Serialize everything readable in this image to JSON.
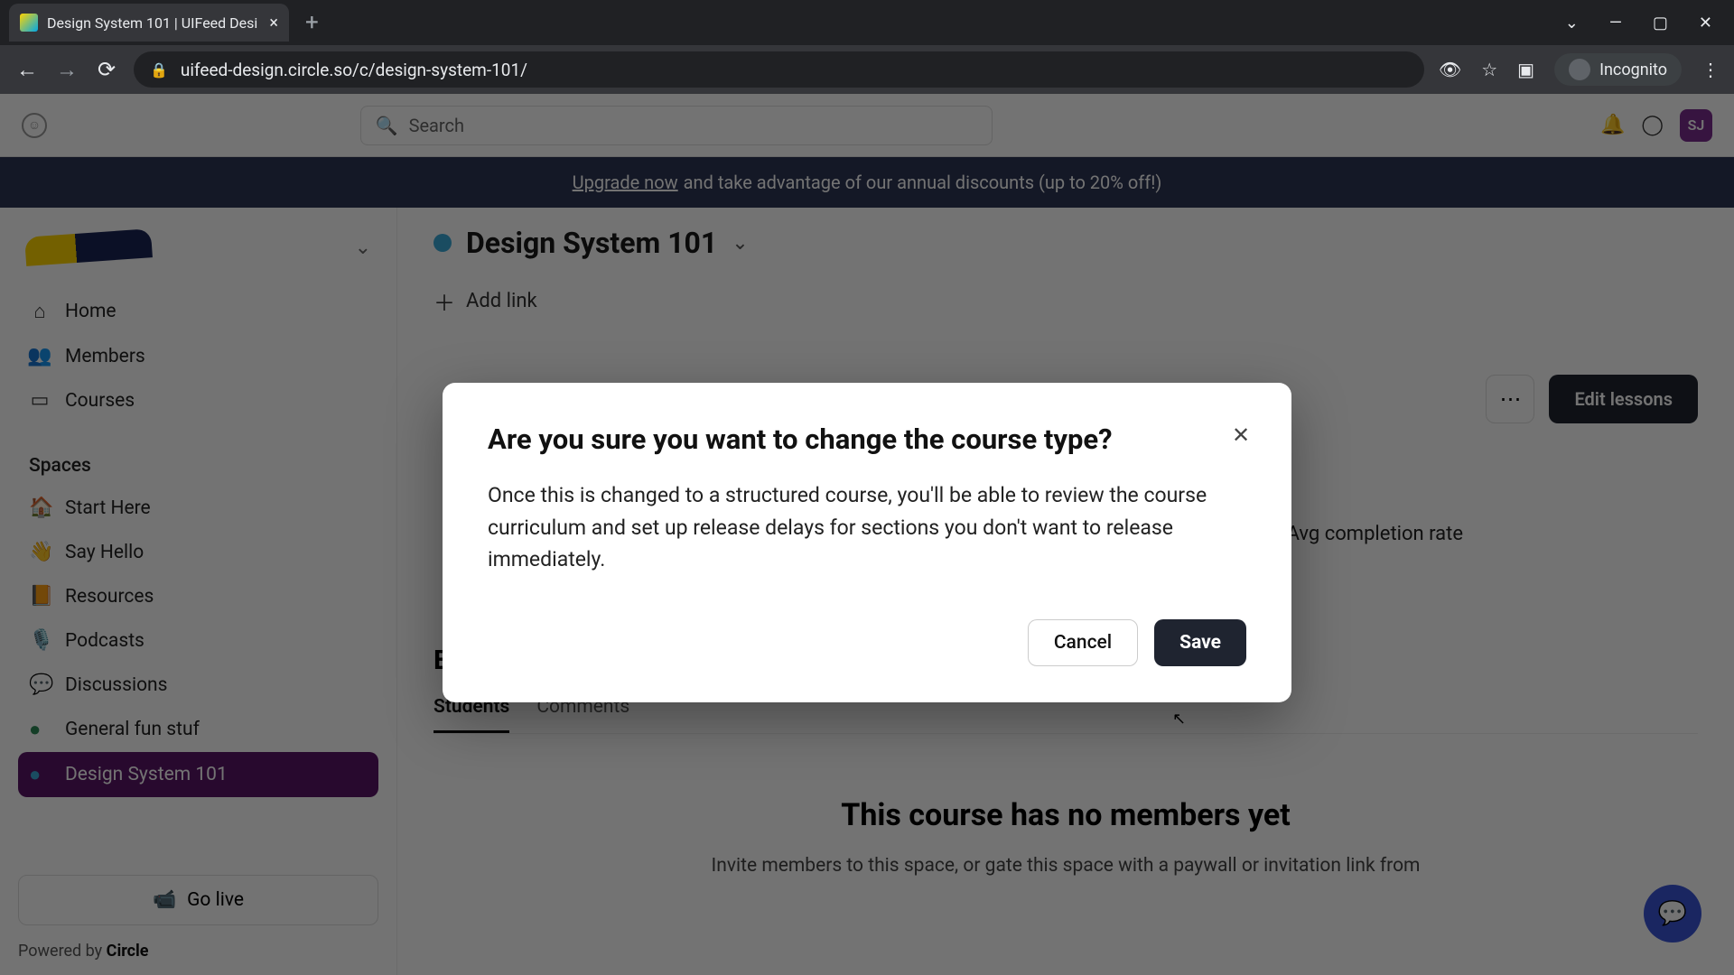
{
  "browser": {
    "tab_title": "Design System 101 | UIFeed Desi",
    "url": "uifeed-design.circle.so/c/design-system-101/",
    "incognito_label": "Incognito"
  },
  "header": {
    "search_placeholder": "Search",
    "avatar_initials": "SJ"
  },
  "banner": {
    "upgrade": "Upgrade now",
    "rest": " and take advantage of our annual discounts (up to 20% off!)"
  },
  "sidebar": {
    "nav": [
      {
        "icon": "⌂",
        "label": "Home"
      },
      {
        "icon": "👥",
        "label": "Members"
      },
      {
        "icon": "▭",
        "label": "Courses"
      }
    ],
    "section_label": "Spaces",
    "spaces": [
      {
        "emoji": "🏠",
        "label": "Start Here"
      },
      {
        "emoji": "👋",
        "label": "Say Hello"
      },
      {
        "emoji": "📙",
        "label": "Resources"
      },
      {
        "emoji": "🎙️",
        "label": "Podcasts"
      },
      {
        "emoji": "💬",
        "label": "Discussions"
      },
      {
        "emoji": "●",
        "label": "General fun stuf"
      },
      {
        "emoji": "●",
        "label": "Design System 101"
      }
    ],
    "go_live": "Go live",
    "powered_prefix": "Powered by ",
    "powered_brand": "Circle"
  },
  "main": {
    "title": "Design System 101",
    "add_link": "Add link",
    "more": "⋯",
    "edit_lessons": "Edit lessons",
    "stat_label": "Avg completion rate",
    "engagement_heading": "Engagement",
    "tabs": {
      "students": "Students",
      "comments": "Comments"
    },
    "empty_title": "This course has no members yet",
    "empty_sub": "Invite members to this space, or gate this space with a paywall or invitation link from"
  },
  "modal": {
    "title": "Are you sure you want to change the course type?",
    "body": "Once this is changed to a structured course, you'll be able to review the course curriculum and set up release delays for sections you don't want to release immediately.",
    "cancel": "Cancel",
    "save": "Save"
  }
}
